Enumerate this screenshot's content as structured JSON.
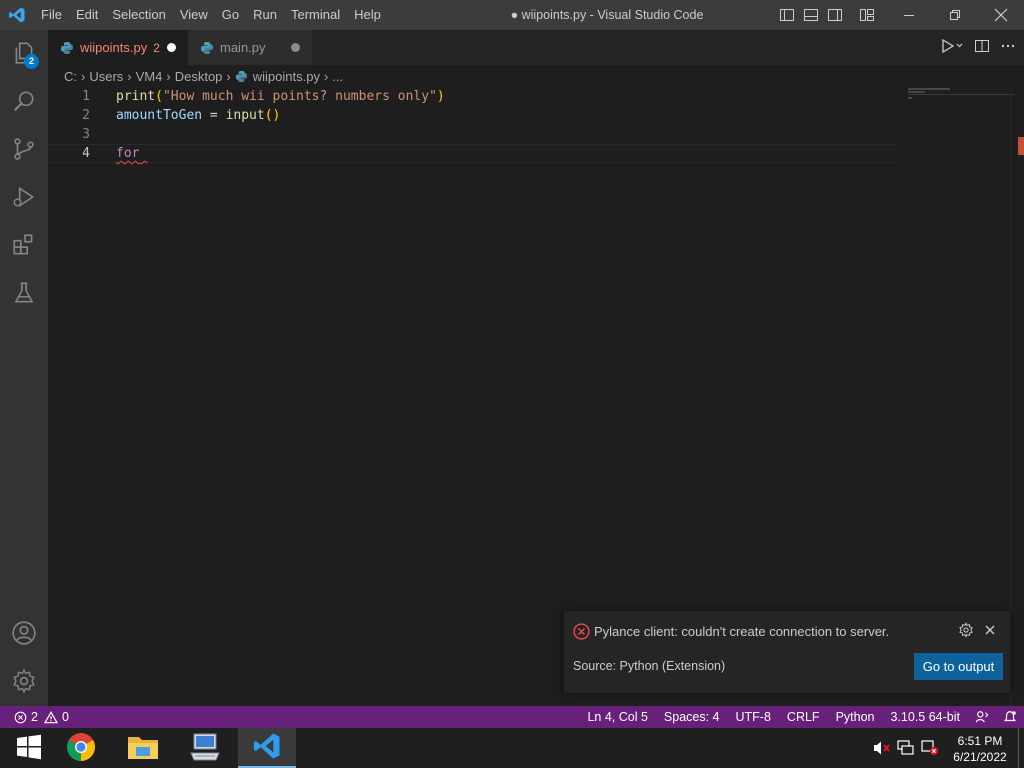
{
  "window": {
    "title": "● wiipoints.py - Visual Studio Code"
  },
  "menu": [
    "File",
    "Edit",
    "Selection",
    "View",
    "Go",
    "Run",
    "Terminal",
    "Help"
  ],
  "activity_bar": {
    "explorer_badge": "2"
  },
  "tabs": [
    {
      "label": "wiipoints.py",
      "problems": "2",
      "active": true,
      "dirty": true
    },
    {
      "label": "main.py",
      "active": false,
      "dirty": true
    }
  ],
  "breadcrumb": [
    "C:",
    "Users",
    "VM4",
    "Desktop",
    "wiipoints.py",
    "..."
  ],
  "editor": {
    "lines": [
      {
        "number": "1",
        "tokens": [
          {
            "text": "print",
            "kind": "fn"
          },
          {
            "text": "(",
            "kind": "paren"
          },
          {
            "text": "\"How much wii points? numbers only\"",
            "kind": "str"
          },
          {
            "text": ")",
            "kind": "paren"
          }
        ]
      },
      {
        "number": "2",
        "tokens": [
          {
            "text": "amountToGen",
            "kind": "var"
          },
          {
            "text": " = ",
            "kind": "op"
          },
          {
            "text": "input",
            "kind": "fn"
          },
          {
            "text": "()",
            "kind": "paren"
          }
        ]
      },
      {
        "number": "3",
        "tokens": []
      },
      {
        "number": "4",
        "tokens": [
          {
            "text": "for",
            "kind": "kw",
            "error": true
          },
          {
            "text": " ",
            "kind": "op",
            "error": true
          }
        ]
      }
    ],
    "current_line": "4"
  },
  "notification": {
    "message": "Pylance client: couldn't create connection to server.",
    "source": "Source: Python (Extension)",
    "action": "Go to output"
  },
  "status_bar": {
    "errors": "2",
    "warnings": "0",
    "cursor": "Ln 4, Col 5",
    "spaces": "Spaces: 4",
    "encoding": "UTF-8",
    "eol": "CRLF",
    "language": "Python",
    "interpreter": "3.10.5 64-bit"
  },
  "taskbar": {
    "time": "6:51 PM",
    "date": "6/21/2022"
  },
  "colors": {
    "status_bar": "#68217a",
    "notification_button": "#0e639c",
    "error": "#f48771",
    "accent": "#007acc"
  }
}
